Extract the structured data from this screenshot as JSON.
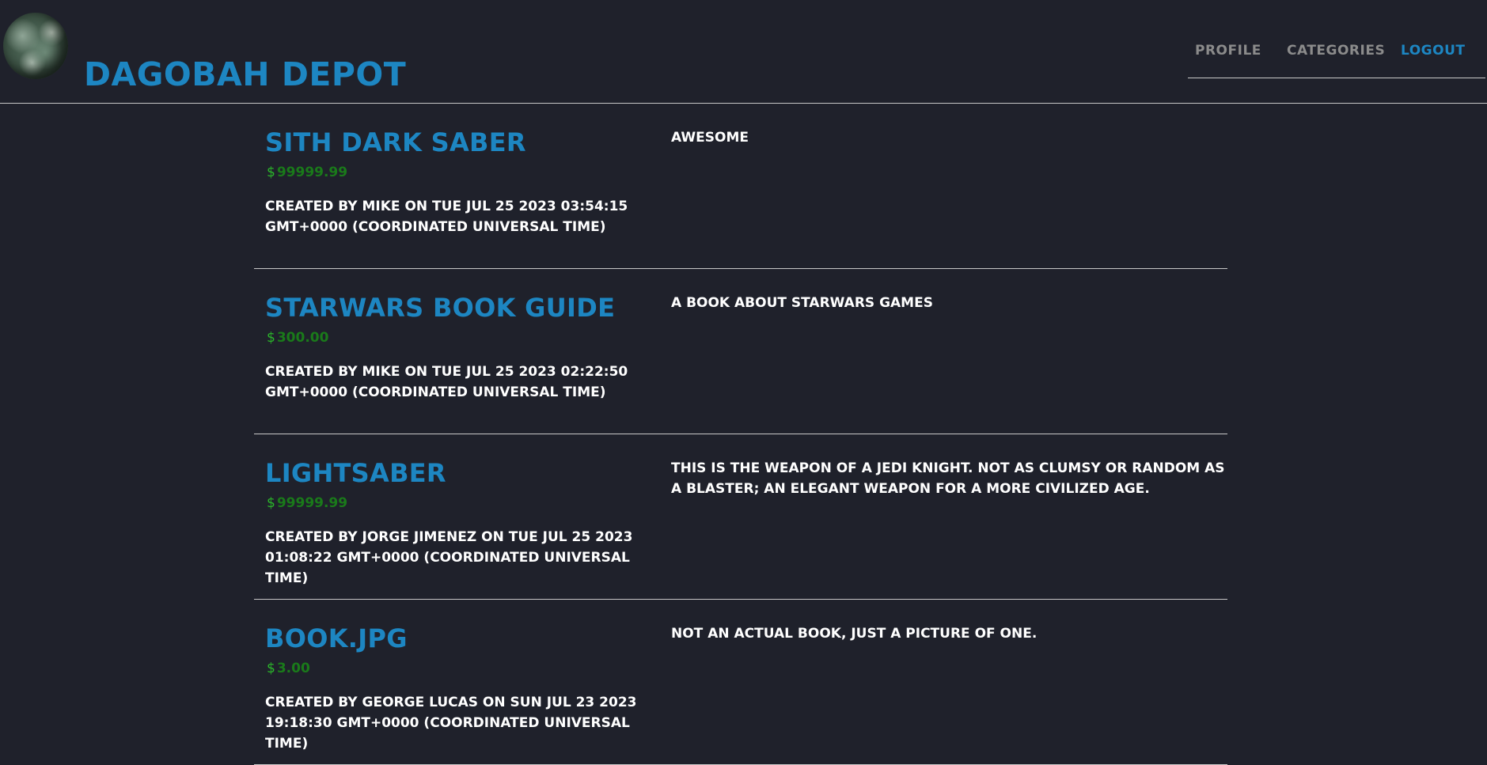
{
  "header": {
    "brand": "Dagobah Depot",
    "logo_icon": "planet-logo-icon",
    "nav": {
      "profile": "Profile",
      "categories": "Categories",
      "logout": "Logout"
    }
  },
  "colors": {
    "background": "#1f212b",
    "accent": "#1d86c2",
    "price": "#1a7a1a",
    "muted": "#8b8b8b"
  },
  "items": [
    {
      "title": "Sith Dark Saber",
      "currency": "$",
      "price": "99999.99",
      "meta": "Created by Mike on Tue Jul 25 2023 03:54:15 GMT+0000 (Coordinated Universal Time)",
      "description": "awesome"
    },
    {
      "title": "StarWars Book Guide",
      "currency": "$",
      "price": "300.00",
      "meta": "Created by Mike on Tue Jul 25 2023 02:22:50 GMT+0000 (Coordinated Universal Time)",
      "description": "A book about starwars games"
    },
    {
      "title": "Lightsaber",
      "currency": "$",
      "price": "99999.99",
      "meta": "Created by Jorge Jimenez on Tue Jul 25 2023 01:08:22 GMT+0000 (Coordinated Universal Time)",
      "description": "This is the weapon of a Jedi Knight. Not as clumsy or random as a blaster; an elegant weapon for a more civilized age."
    },
    {
      "title": "book.jpg",
      "currency": "$",
      "price": "3.00",
      "meta": "Created by George Lucas on Sun Jul 23 2023 19:18:30 GMT+0000 (Coordinated Universal Time)",
      "description": "Not an actual book, just a picture of one."
    }
  ]
}
